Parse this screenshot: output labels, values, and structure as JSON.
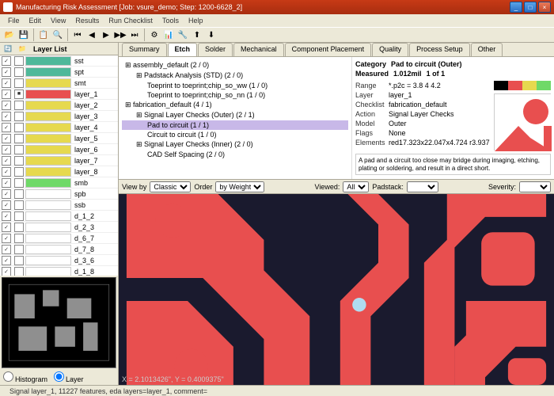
{
  "window": {
    "title": "Manufacturing Risk Assessment [Job: vsure_demo; Step: 1200-6628_2]"
  },
  "menu": [
    "File",
    "Edit",
    "View",
    "Results",
    "Run Checklist",
    "Tools",
    "Help"
  ],
  "layerlist": {
    "title": "Layer List",
    "items": [
      {
        "name": "sst",
        "color": "#4fb89a",
        "checked": true
      },
      {
        "name": "spt",
        "color": "#4fb89a",
        "checked": true
      },
      {
        "name": "smt",
        "color": "#e6d94f",
        "checked": true
      },
      {
        "name": "layer_1",
        "color": "#e84f4f",
        "checked": true,
        "active": true
      },
      {
        "name": "layer_2",
        "color": "#e6d94f",
        "checked": true
      },
      {
        "name": "layer_3",
        "color": "#e6d94f",
        "checked": true
      },
      {
        "name": "layer_4",
        "color": "#e6d94f",
        "checked": true
      },
      {
        "name": "layer_5",
        "color": "#e6d94f",
        "checked": true
      },
      {
        "name": "layer_6",
        "color": "#e6d94f",
        "checked": true
      },
      {
        "name": "layer_7",
        "color": "#e6d94f",
        "checked": true
      },
      {
        "name": "layer_8",
        "color": "#e6d94f",
        "checked": true
      },
      {
        "name": "smb",
        "color": "#6fd968",
        "checked": true
      },
      {
        "name": "spb",
        "color": "",
        "checked": true
      },
      {
        "name": "ssb",
        "color": "",
        "checked": true
      },
      {
        "name": "d_1_2",
        "color": "",
        "checked": true
      },
      {
        "name": "d_2_3",
        "color": "",
        "checked": true
      },
      {
        "name": "d_6_7",
        "color": "",
        "checked": true
      },
      {
        "name": "d_7_8",
        "color": "",
        "checked": true
      },
      {
        "name": "d_3_6",
        "color": "",
        "checked": true
      },
      {
        "name": "d_1_8",
        "color": "",
        "checked": true
      }
    ]
  },
  "tabs": [
    "Summary",
    "Etch",
    "Solder",
    "Mechanical",
    "Component Placement",
    "Quality",
    "Process Setup",
    "Other"
  ],
  "active_tab": "Etch",
  "tree": [
    {
      "l": 1,
      "t": "assembly_default (2 / 0)"
    },
    {
      "l": 2,
      "t": "Padstack Analysis (STD) (2 / 0)"
    },
    {
      "l": 3,
      "t": "Toeprint to toeprint;chip_so_ww (1 / 0)"
    },
    {
      "l": 3,
      "t": "Toeprint to toeprint;chip_so_nn (1 / 0)"
    },
    {
      "l": 1,
      "t": "fabrication_default (4 / 1)"
    },
    {
      "l": 2,
      "t": "Signal Layer Checks (Outer) (2 / 1)"
    },
    {
      "l": 3,
      "t": "Pad to circuit (1 / 1)",
      "sel": true
    },
    {
      "l": 3,
      "t": "Circuit to circuit (1 / 0)"
    },
    {
      "l": 2,
      "t": "Signal Layer Checks (Inner) (2 / 0)"
    },
    {
      "l": 3,
      "t": "CAD Self Spacing (2 / 0)"
    }
  ],
  "detail": {
    "category_lbl": "Category",
    "category": "Pad to circuit  (Outer)",
    "measured_lbl": "Measured",
    "measured": "1.012mil",
    "count": "1 of 1",
    "rows": [
      {
        "k": "Range",
        "v": "*.p2c = 3.8 4 4.2"
      },
      {
        "k": "Layer",
        "v": "layer_1"
      },
      {
        "k": "Checklist",
        "v": "fabrication_default"
      },
      {
        "k": "Action",
        "v": "Signal Layer Checks"
      },
      {
        "k": "Model",
        "v": "Outer"
      },
      {
        "k": "Flags",
        "v": "None"
      },
      {
        "k": "Elements",
        "v": "red17.323x22.047x4.724     r3.937"
      }
    ],
    "note": "A pad and a circuit too close may bridge during imaging, etching, plating or soldering, and result in a direct short."
  },
  "filters": {
    "viewby_lbl": "View by",
    "viewby": "Classic",
    "order_lbl": "Order",
    "order": "by Weight",
    "viewed_lbl": "Viewed:",
    "viewed": "All",
    "padstack_lbl": "Padstack:",
    "severity_lbl": "Severity:"
  },
  "radios": {
    "histogram": "Histogram",
    "layer": "Layer"
  },
  "coords": "X = 2.1013426\", Y = 0.4009375\"",
  "status": "Signal layer_1, 11227 features, eda layers=layer_1, comment="
}
